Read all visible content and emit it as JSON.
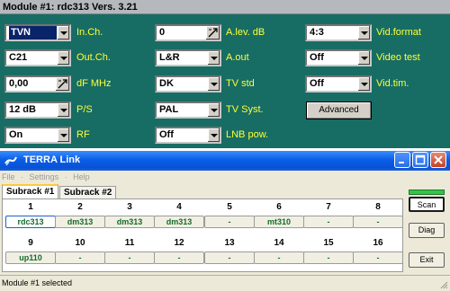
{
  "module": {
    "title": "Module #1:  rdc313  Vers. 3.21",
    "controls": {
      "in_ch": {
        "value": "TVN TURBO",
        "label": "In.Ch."
      },
      "out_ch": {
        "value": "C21",
        "label": "Out.Ch."
      },
      "df_mhz": {
        "value": "0,00",
        "label": "dF MHz"
      },
      "ps": {
        "value": "12 dB",
        "label": "P/S"
      },
      "rf": {
        "value": "On",
        "label": "RF"
      },
      "a_lev": {
        "value": "0",
        "label": "A.lev. dB"
      },
      "a_out": {
        "value": "L&R",
        "label": "A.out"
      },
      "tv_std": {
        "value": "DK",
        "label": "TV std"
      },
      "tv_syst": {
        "value": "PAL",
        "label": "TV Syst."
      },
      "lnb_pow": {
        "value": "Off",
        "label": "LNB pow."
      },
      "vid_format": {
        "value": "4:3",
        "label": "Vid.format"
      },
      "video_test": {
        "value": "Off",
        "label": "Video test"
      },
      "vid_tim": {
        "value": "Off",
        "label": "Vid.tim."
      }
    },
    "advanced_label": "Advanced"
  },
  "window": {
    "title": "TERRA Link",
    "menu": [
      "File",
      "·",
      "Settings",
      "·",
      "Help"
    ],
    "tabs": [
      "Subrack #1",
      "Subrack #2"
    ],
    "slots_row1": [
      {
        "num": "1",
        "value": "rdc313"
      },
      {
        "num": "2",
        "value": "dm313"
      },
      {
        "num": "3",
        "value": "dm313"
      },
      {
        "num": "4",
        "value": "dm313"
      },
      {
        "num": "5",
        "value": "-"
      },
      {
        "num": "6",
        "value": "mt310"
      },
      {
        "num": "7",
        "value": "-"
      },
      {
        "num": "8",
        "value": "-"
      }
    ],
    "slots_row2": [
      {
        "num": "9",
        "value": "up110"
      },
      {
        "num": "10",
        "value": "-"
      },
      {
        "num": "11",
        "value": "-"
      },
      {
        "num": "12",
        "value": "-"
      },
      {
        "num": "13",
        "value": "-"
      },
      {
        "num": "14",
        "value": "-"
      },
      {
        "num": "15",
        "value": "-"
      },
      {
        "num": "16",
        "value": "-"
      }
    ],
    "buttons": {
      "scan": "Scan",
      "diag": "Diag",
      "exit": "Exit"
    },
    "status": "Module #1 selected"
  },
  "colors": {
    "panel_bg": "#176d64",
    "label_yellow": "#ffff33",
    "slot_text_green": "#146c2c"
  }
}
